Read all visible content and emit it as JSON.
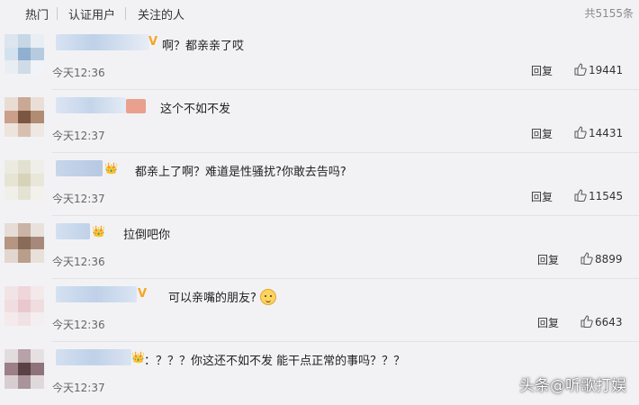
{
  "tabs": [
    {
      "label": "热门"
    },
    {
      "label": "认证用户"
    },
    {
      "label": "关注的人"
    }
  ],
  "total_label": "共5155条",
  "comments": [
    {
      "text": "啊？都亲亲了哎",
      "time": "今天12:36",
      "reply": "回复",
      "likes": "19441",
      "badge": "V"
    },
    {
      "text": "这个不如不发",
      "time": "今天12:37",
      "reply": "回复",
      "likes": "14431",
      "badge": "red"
    },
    {
      "text": "都亲上了啊？难道是性骚扰?你敢去告吗?",
      "time": "今天12:37",
      "reply": "回复",
      "likes": "11545",
      "badge": "crown"
    },
    {
      "text": "拉倒吧你",
      "time": "今天12:36",
      "reply": "回复",
      "likes": "8899",
      "badge": "crown"
    },
    {
      "text": "可以亲嘴的朋友?",
      "time": "今天12:36",
      "reply": "回复",
      "likes": "6643",
      "badge": "V"
    },
    {
      "text": "：？？？你这还不如不发 能干点正常的事吗？？？",
      "time": "今天12:37",
      "reply": "",
      "likes": "",
      "badge": "crown"
    }
  ],
  "watermark": "头条@听歌打娱"
}
